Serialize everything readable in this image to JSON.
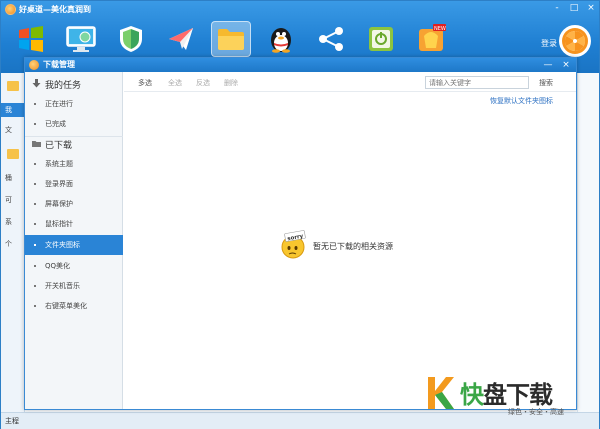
{
  "app": {
    "title": "好桌道—美化真润到",
    "login_label": "登录",
    "sys_label": "系",
    "toolbar_icons": [
      "windows-logo-icon",
      "monitor-icon",
      "shield-icon",
      "paper-plane-icon",
      "folder-icon",
      "qq-penguin-icon",
      "share-icon",
      "switch-tool-icon",
      "fruit-new-icon"
    ],
    "window_controls": [
      "-",
      "□",
      "×"
    ]
  },
  "main_left": {
    "items": [
      "我",
      "文",
      "桶",
      "可",
      "系",
      "个"
    ]
  },
  "status_bar": {
    "text": "主程"
  },
  "dialog": {
    "title": "下载管理",
    "controls": [
      "—",
      "×"
    ],
    "sidebar": {
      "my_tasks": {
        "label": "我的任务",
        "items": [
          "正在进行",
          "已完成"
        ]
      },
      "downloaded": {
        "label": "已下载",
        "items": [
          "系统主题",
          "登录界面",
          "屏幕保护",
          "鼠标指针",
          "文件夹图标",
          "QQ美化",
          "开关机音乐",
          "右键菜单美化"
        ],
        "active_index": 4
      }
    },
    "toolbar": {
      "actions": [
        "多选",
        "全选",
        "反选",
        "删除"
      ],
      "search_placeholder": "请输入关键字",
      "search_button": "搜索"
    },
    "restore_link": "恢复默认文件夹图标",
    "empty_text": "暂无已下载的相关资源",
    "sorry_label": "sorry"
  },
  "watermark": {
    "k": "K",
    "kuai": "快",
    "rest": "盘下载",
    "sub": "绿色・安全・高速"
  },
  "colors": {
    "titlebar": "#1f7fd2",
    "active_item": "#2a84d6",
    "link": "#2a6fc2",
    "watermark_green": "#3aa646",
    "watermark_orange": "#f39a1e"
  }
}
